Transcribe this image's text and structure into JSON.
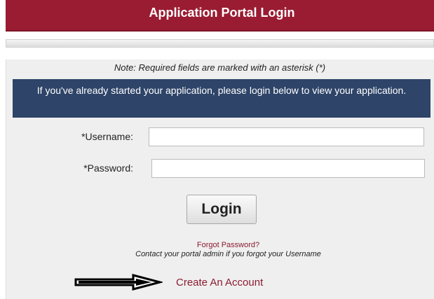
{
  "header": {
    "title": "Application Portal Login"
  },
  "form": {
    "note": "Note: Required fields are marked with an asterisk (*)",
    "info": "If you've already started your application, please login below to view your application.",
    "username_label": "*Username:",
    "username_value": "",
    "password_label": "*Password:",
    "password_value": "",
    "login_label": "Login"
  },
  "links": {
    "forgot_password": "Forgot Password?",
    "contact_note": "Contact your portal admin if you forgot your Username",
    "create_account": "Create An Account"
  },
  "colors": {
    "brand_red": "#9a1c32",
    "info_navy": "#2e4468",
    "link_red": "#8a1c30"
  },
  "icons": {
    "annotation_arrow": "right-arrow-icon"
  }
}
